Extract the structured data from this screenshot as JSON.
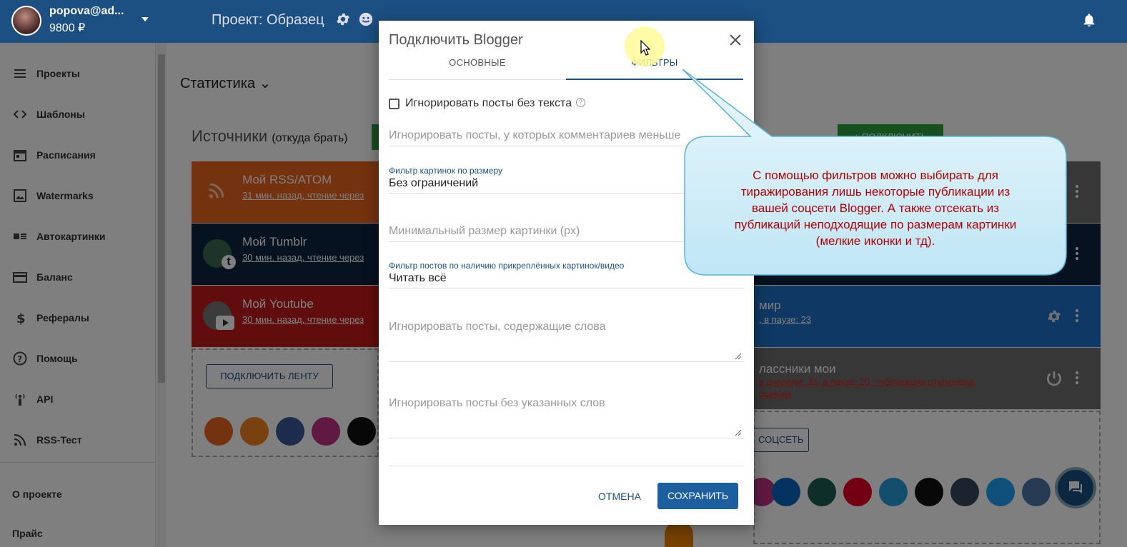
{
  "header": {
    "user": "popova@ad...",
    "balance": "9800 ₽",
    "project": "Проект: Образец"
  },
  "sidebar": {
    "items": [
      {
        "label": "Проекты",
        "icon": "list-icon"
      },
      {
        "label": "Шаблоны",
        "icon": "code-icon"
      },
      {
        "label": "Расписания",
        "icon": "calendar-icon"
      },
      {
        "label": "Watermarks",
        "icon": "watermark-icon"
      },
      {
        "label": "Автокартинки",
        "icon": "autoimage-icon"
      },
      {
        "label": "Баланс",
        "icon": "card-icon"
      },
      {
        "label": "Рефералы",
        "icon": "dollar-icon"
      },
      {
        "label": "Помощь",
        "icon": "help-icon"
      },
      {
        "label": "API",
        "icon": "api-icon"
      },
      {
        "label": "RSS-Тест",
        "icon": "rss-icon"
      }
    ],
    "footer": [
      "О проекте",
      "Прайс"
    ]
  },
  "main": {
    "stats": "Статистика",
    "sources_title": "Источники",
    "sources_sub": "(откуда брать)",
    "connect_feed": "ПОДКЛЮЧИТЬ ЛЕНТУ",
    "connect_green": "ПОДКЛЮЧИТЬ",
    "cards": [
      {
        "title": "Мой RSS/ATOM",
        "sub": "31 мин. назад, чтение через"
      },
      {
        "title": "Мой Tumblr",
        "sub": "30 мин. назад, чтение через"
      },
      {
        "title": "Мой Youtube",
        "sub": "30 мин. назад, чтение через"
      }
    ],
    "right_cards": [
      {
        "title": "мир",
        "sub": ", в паузе: 23"
      },
      {
        "title": "лассники мои",
        "sub": "в очереди: 35, в паузе: 20, публикация отключена,",
        "sub2": "ошибки"
      }
    ],
    "connect_social": "СОЦСЕТЬ"
  },
  "modal": {
    "title": "Подключить Blogger",
    "tabs": [
      "ОСНОВНЫЕ",
      "ФИЛЬТРЫ"
    ],
    "ignore_no_text": "Игнорировать посты без текста",
    "comments_placeholder": "Игнорировать посты, у которых комментариев меньше",
    "img_filter_label": "Фильтр картинок по размеру",
    "img_filter_value": "Без ограничений",
    "min_size_placeholder": "Минимальный размер картинки (px)",
    "attach_filter_label": "Фильтр постов по наличию прикреплённых картинок/видео",
    "attach_filter_value": "Читать всё",
    "words_placeholder": "Игнорировать посты, содержащие слова",
    "no_words_placeholder": "Игнорировать посты без указанных слов",
    "cancel": "ОТМЕНА",
    "save": "СОХРАНИТЬ"
  },
  "tooltip": {
    "lines": [
      "С помощью фильтров можно выбирать для",
      "тиражирования лишь некоторые публикации из",
      "вашей соцсети Blogger. А также отсекать из",
      "публикаций неподходящие по размерам картинки",
      "(мелкие иконки и тд)."
    ]
  },
  "colors": {
    "header": "#1c4f82",
    "rss": "#e8641d",
    "tumblr": "#0f2540",
    "youtube": "#c41b1b",
    "blue_card": "#1e72c8",
    "gray_card": "#6e6e6e",
    "accent": "#1c5fa0",
    "tip_text": "#b40000"
  }
}
